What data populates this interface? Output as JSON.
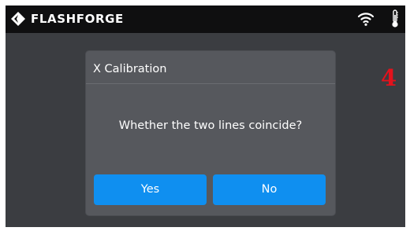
{
  "topbar": {
    "brand": "FLASHFORGE",
    "icons": [
      "flashforge-logo-icon",
      "wifi-icon",
      "thermometer-icon"
    ]
  },
  "annotation": {
    "number": "4",
    "color": "#e3121c"
  },
  "dialog": {
    "title": "X Calibration",
    "message": "Whether the two lines coincide?",
    "buttons": {
      "yes": "Yes",
      "no": "No"
    }
  },
  "colors": {
    "screen_bg": "#3b3d41",
    "topbar_bg": "#0f0f10",
    "dialog_bg": "#56585d",
    "button": "#0f8ff0"
  }
}
